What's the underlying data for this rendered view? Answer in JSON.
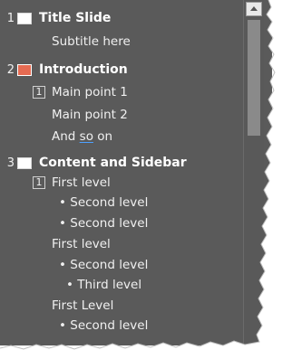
{
  "slides": [
    {
      "num": "1",
      "title": "Title Slide",
      "active": false,
      "lines": [
        {
          "text": "Subtitle here"
        }
      ]
    },
    {
      "num": "2",
      "title": "Introduction",
      "active": true,
      "lines": [
        {
          "text": "Main point 1",
          "box": "1"
        },
        {
          "text": "Main point 2"
        },
        {
          "pre": "And ",
          "spell": "so",
          "post": " on"
        }
      ]
    },
    {
      "num": "3",
      "title": "Content and Sidebar",
      "active": false,
      "lines": [
        {
          "text": "First level",
          "box": "1"
        },
        {
          "text": "• Second level"
        },
        {
          "text": "• Second level"
        },
        {
          "text": "First level"
        },
        {
          "text": "• Second level"
        },
        {
          "text": "• Third level"
        },
        {
          "text": "First Level"
        },
        {
          "text": "• Second level"
        }
      ]
    }
  ],
  "colors": {
    "panel": "#5a5a5a",
    "active_thumb": "#e66b52",
    "text": "#f0f0f0"
  }
}
